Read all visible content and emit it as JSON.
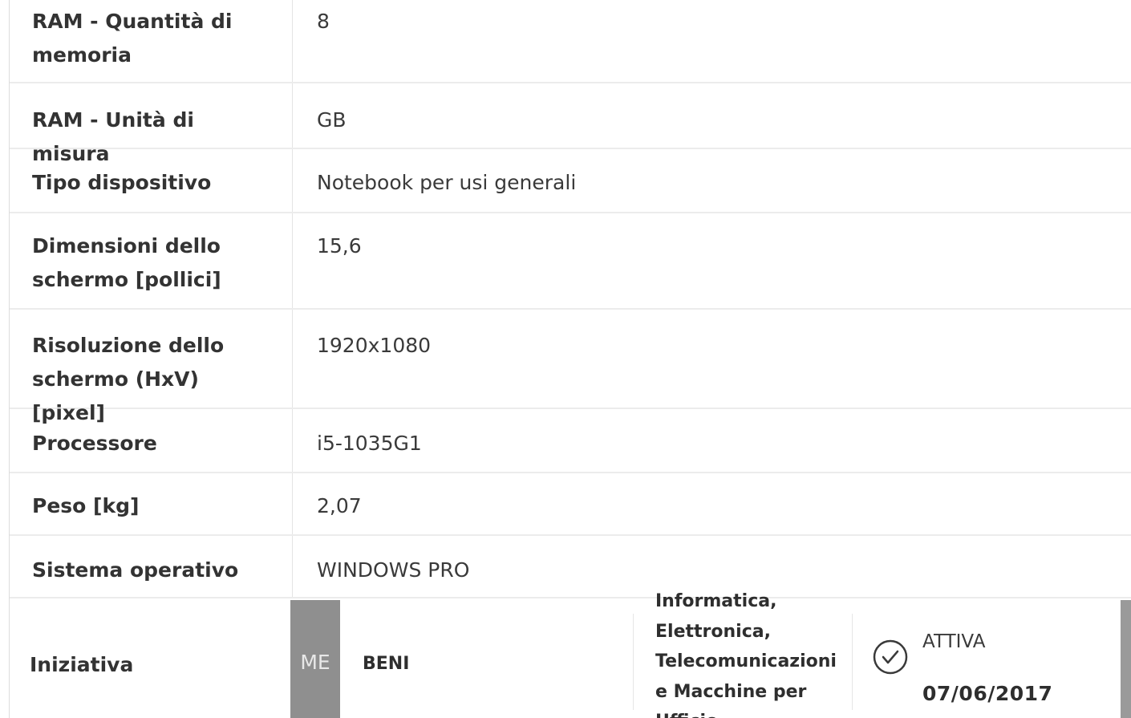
{
  "specs": [
    {
      "label": "RAM - Quantità di memoria",
      "value": "8"
    },
    {
      "label": "RAM - Unità di misura",
      "value": "GB"
    },
    {
      "label": "Tipo dispositivo",
      "value": "Notebook per usi generali"
    },
    {
      "label": "Dimensioni dello schermo [pollici]",
      "value": "15,6"
    },
    {
      "label": "Risoluzione dello schermo (HxV) [pixel]",
      "value": "1920x1080"
    },
    {
      "label": "Processore",
      "value": "i5-1035G1"
    },
    {
      "label": "Peso [kg]",
      "value": "2,07"
    },
    {
      "label": "Sistema operativo",
      "value": "WINDOWS PRO"
    }
  ],
  "initiative": {
    "label": "Iniziativa",
    "badge": "ME",
    "type": "BENI",
    "category": "Informatica, Elettronica, Telecomunicazioni e Macchine per Ufficio",
    "status": "ATTIVA",
    "date": "07/06/2017",
    "status_icon": "check-circle-icon"
  }
}
